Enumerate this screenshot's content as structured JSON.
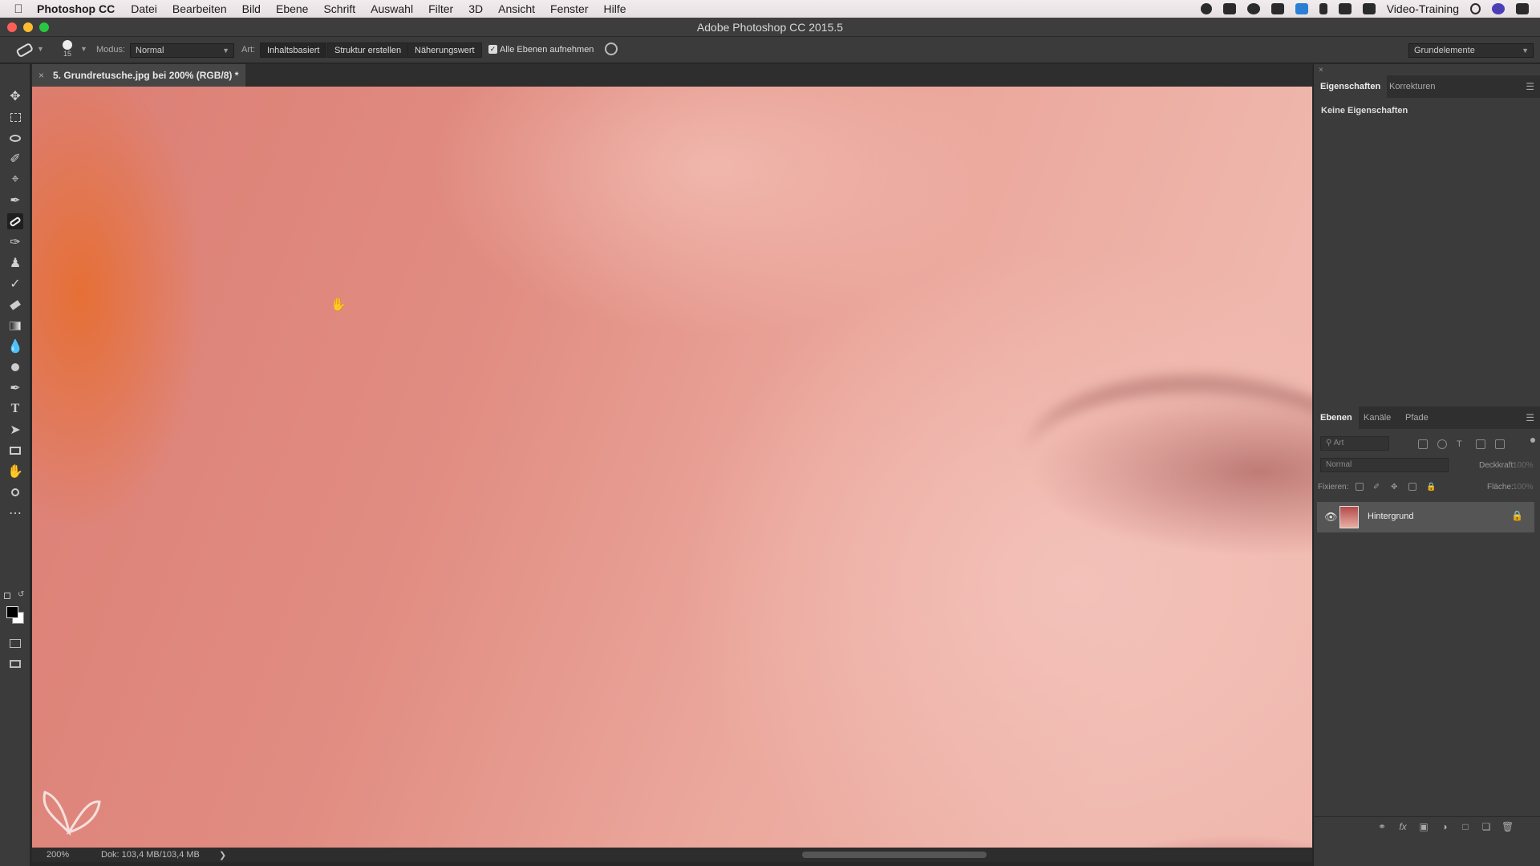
{
  "menubar": {
    "app": "Photoshop CC",
    "items": [
      "Datei",
      "Bearbeiten",
      "Bild",
      "Ebene",
      "Schrift",
      "Auswahl",
      "Filter",
      "3D",
      "Ansicht",
      "Fenster",
      "Hilfe"
    ],
    "user": "Video-Training"
  },
  "titlebar": {
    "title": "Adobe Photoshop CC 2015.5"
  },
  "options": {
    "brush_size": "15",
    "mode_label": "Modus:",
    "mode_value": "Normal",
    "type_label": "Art:",
    "type_buttons": [
      "Inhaltsbasiert",
      "Struktur erstellen",
      "Näherungswert"
    ],
    "sample_all_label": "Alle Ebenen aufnehmen",
    "sample_all_checked": true,
    "workspace": "Grundelemente"
  },
  "document": {
    "tab_title": "5. Grundretusche.jpg bei 200% (RGB/8) *"
  },
  "status": {
    "zoom": "200%",
    "doc_size": "Dok: 103,4 MB/103,4 MB"
  },
  "properties_panel": {
    "tabs": [
      "Eigenschaften",
      "Korrekturen"
    ],
    "active_tab": "Eigenschaften",
    "content": "Keine Eigenschaften"
  },
  "layers_panel": {
    "tabs": [
      "Ebenen",
      "Kanäle",
      "Pfade"
    ],
    "active_tab": "Ebenen",
    "search_placeholder": "Art",
    "blend_mode": "Normal",
    "opacity_label": "Deckkraft:",
    "opacity_value": "100%",
    "lock_label": "Fixieren:",
    "fill_label": "Fläche:",
    "fill_value": "100%",
    "layers": [
      {
        "name": "Hintergrund",
        "visible": true,
        "locked": true
      }
    ]
  },
  "colors": {
    "foreground": "#000000",
    "background": "#ffffff"
  }
}
